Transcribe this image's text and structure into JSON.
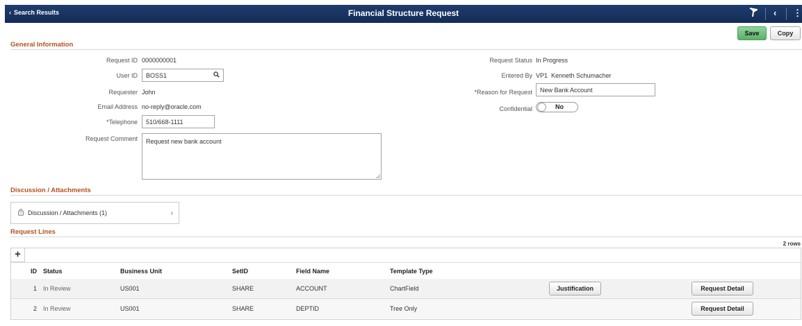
{
  "header": {
    "back_label": "Search Results",
    "title": "Financial Structure Request"
  },
  "toolbar": {
    "save_label": "Save",
    "copy_label": "Copy"
  },
  "general": {
    "section_title": "General Information",
    "request_id_label": "Request ID",
    "request_id": "0000000001",
    "user_id_label": "User ID",
    "user_id": "BOSS1",
    "requester_label": "Requester",
    "requester": "John",
    "email_label": "Email Address",
    "email": "no-reply@oracle.com",
    "telephone_label": "*Telephone",
    "telephone": "510/668-1111",
    "comment_label": "Request Comment",
    "comment": "Request new bank account",
    "status_label": "Request Status",
    "status": "In Progress",
    "entered_by_label": "Entered By",
    "entered_by": "VP1  Kenneth Schumacher",
    "reason_label": "*Reason for Request",
    "reason": "New Bank Account",
    "confidential_label": "Confidential",
    "confidential": "No"
  },
  "discussion": {
    "section_title": "Discussion / Attachments",
    "link_label": "Discussion / Attachments (1)"
  },
  "lines": {
    "section_title": "Request Lines",
    "rows_count": "2 rows",
    "add_symbol": "+",
    "columns": {
      "id": "ID",
      "status": "Status",
      "business_unit": "Business Unit",
      "setid": "SetID",
      "field_name": "Field Name",
      "template_type": "Template Type"
    },
    "rows": [
      {
        "id": "1",
        "status": "In Review",
        "business_unit": "US001",
        "setid": "SHARE",
        "field_name": "ACCOUNT",
        "template_type": "ChartField",
        "justification": "Justification",
        "detail": "Request Detail"
      },
      {
        "id": "2",
        "status": "In Review",
        "business_unit": "US001",
        "setid": "SHARE",
        "field_name": "DEPTID",
        "template_type": "Tree Only",
        "detail": "Request Detail"
      }
    ]
  }
}
